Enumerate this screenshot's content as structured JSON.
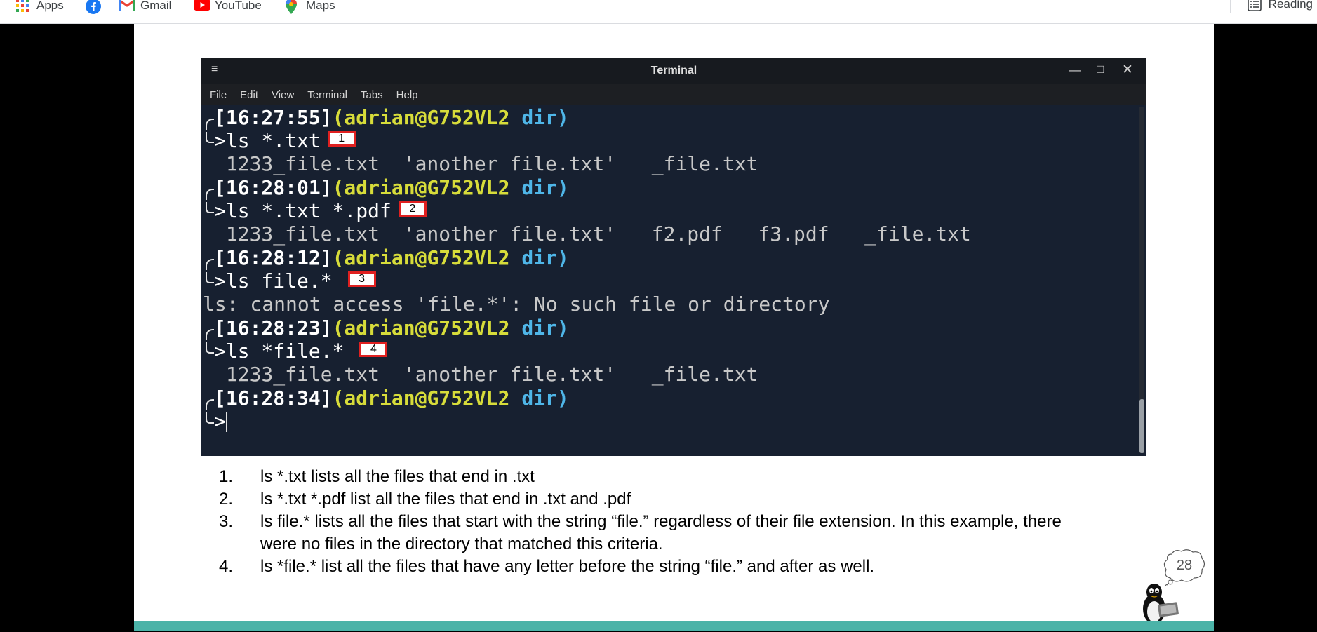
{
  "bookmarks": [
    {
      "label": "Apps",
      "icon": "apps-grid-icon"
    },
    {
      "label": "",
      "icon": "facebook-icon"
    },
    {
      "label": "Gmail",
      "icon": "gmail-icon"
    },
    {
      "label": "YouTube",
      "icon": "youtube-icon"
    },
    {
      "label": "Maps",
      "icon": "maps-icon"
    }
  ],
  "reading_list": {
    "label": "Reading",
    "icon": "reading-list-icon"
  },
  "terminal": {
    "title": "Terminal",
    "menu": [
      "File",
      "Edit",
      "View",
      "Terminal",
      "Tabs",
      "Help"
    ],
    "prompt": {
      "user": "(adrian@G752VL2",
      "dir": "dir)"
    },
    "blocks": [
      {
        "time": "[16:27:55]",
        "command": ">ls *.txt",
        "badge": "1",
        "output": " 1233_file.txt  'another file.txt'   _file.txt"
      },
      {
        "time": "[16:28:01]",
        "command": ">ls *.txt *.pdf",
        "badge": "2",
        "output": " 1233_file.txt  'another file.txt'   f2.pdf   f3.pdf   _file.txt"
      },
      {
        "time": "[16:28:12]",
        "command": ">ls file.*",
        "badge": "3",
        "output": "ls: cannot access 'file.*': No such file or directory"
      },
      {
        "time": "[16:28:23]",
        "command": ">ls *file.*",
        "badge": "4",
        "output": " 1233_file.txt  'another file.txt'   _file.txt"
      },
      {
        "time": "[16:28:34]",
        "command": ">",
        "badge": "",
        "output": ""
      }
    ]
  },
  "notes": [
    {
      "num": "1.",
      "text": "ls *.txt lists all the files that end in .txt"
    },
    {
      "num": "2.",
      "text": "ls *.txt *.pdf list all the files that end in .txt and .pdf"
    },
    {
      "num": "3.",
      "text": "ls file.* lists all the files that start with the string “file.” regardless of their file extension. In this example, there were no files in the directory that matched this criteria."
    },
    {
      "num": "4.",
      "text": "ls *file.* list all the files that have any letter before the string “file.” and after as well."
    }
  ],
  "page_number": "28",
  "colors": {
    "slide_footer": "#4bb3a8",
    "terminal_bg": "#172030",
    "user": "#d7dc3a",
    "dir": "#4fb6e8",
    "badge_border": "#e02020"
  }
}
